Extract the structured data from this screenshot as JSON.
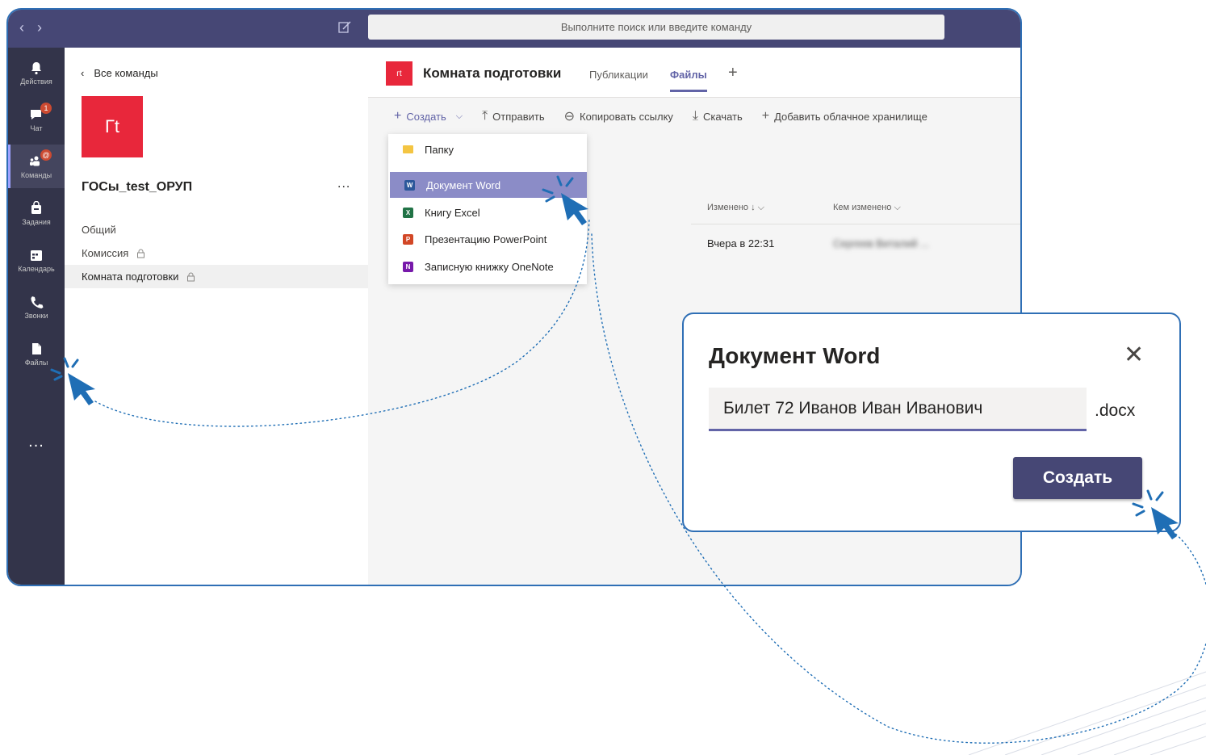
{
  "titlebar": {
    "search_placeholder": "Выполните поиск или введите команду"
  },
  "rail": {
    "items": [
      {
        "label": "Действия",
        "icon": "bell-icon"
      },
      {
        "label": "Чат",
        "icon": "chat-icon",
        "badge": "1"
      },
      {
        "label": "Команды",
        "icon": "teams-icon",
        "badge": "@"
      },
      {
        "label": "Задания",
        "icon": "assignments-icon"
      },
      {
        "label": "Календарь",
        "icon": "calendar-icon"
      },
      {
        "label": "Звонки",
        "icon": "phone-icon"
      },
      {
        "label": "Файлы",
        "icon": "files-icon"
      }
    ],
    "more": "..."
  },
  "team_panel": {
    "back_label": "Все команды",
    "avatar_text": "Гt",
    "team_name": "ГОСы_test_ОРУП",
    "more": "...",
    "channels": [
      {
        "label": "Общий",
        "locked": false
      },
      {
        "label": "Комиссия",
        "locked": true
      },
      {
        "label": "Комната подготовки",
        "locked": true
      }
    ]
  },
  "channel_header": {
    "avatar_text": "гt",
    "title": "Комната подготовки",
    "tabs": [
      "Публикации",
      "Файлы"
    ],
    "active_tab": "Файлы",
    "add_tab": "+"
  },
  "toolbar": {
    "create": "Создать",
    "upload": "Отправить",
    "copy_link": "Копировать ссылку",
    "download": "Скачать",
    "add_storage": "Добавить облачное хранилище"
  },
  "files_table": {
    "col_modified": "Изменено ↓",
    "col_modified_by": "Кем изменено",
    "rows": [
      {
        "modified": "Вчера в 22:31",
        "modified_by": "Сергеев Виталий ..."
      }
    ]
  },
  "create_menu": {
    "items": [
      {
        "label": "Папку",
        "icon": "folder-icon",
        "color": "#f4c542"
      },
      {
        "label": "Документ Word",
        "icon": "word-icon",
        "color": "#2b579a",
        "highlighted": true
      },
      {
        "label": "Книгу Excel",
        "icon": "excel-icon",
        "color": "#217346"
      },
      {
        "label": "Презентацию PowerPoint",
        "icon": "powerpoint-icon",
        "color": "#d24726"
      },
      {
        "label": "Записную книжку OneNote",
        "icon": "onenote-icon",
        "color": "#7719aa"
      }
    ]
  },
  "dialog": {
    "title": "Документ Word",
    "filename": "Билет 72 Иванов Иван Иванович",
    "extension": ".docx",
    "create_button": "Создать",
    "close": "✕"
  },
  "colors": {
    "titlebar": "#464775",
    "rail": "#33344a",
    "accent": "#6264a7",
    "team_red": "#e8273b",
    "callout_blue": "#2f6fb5"
  }
}
